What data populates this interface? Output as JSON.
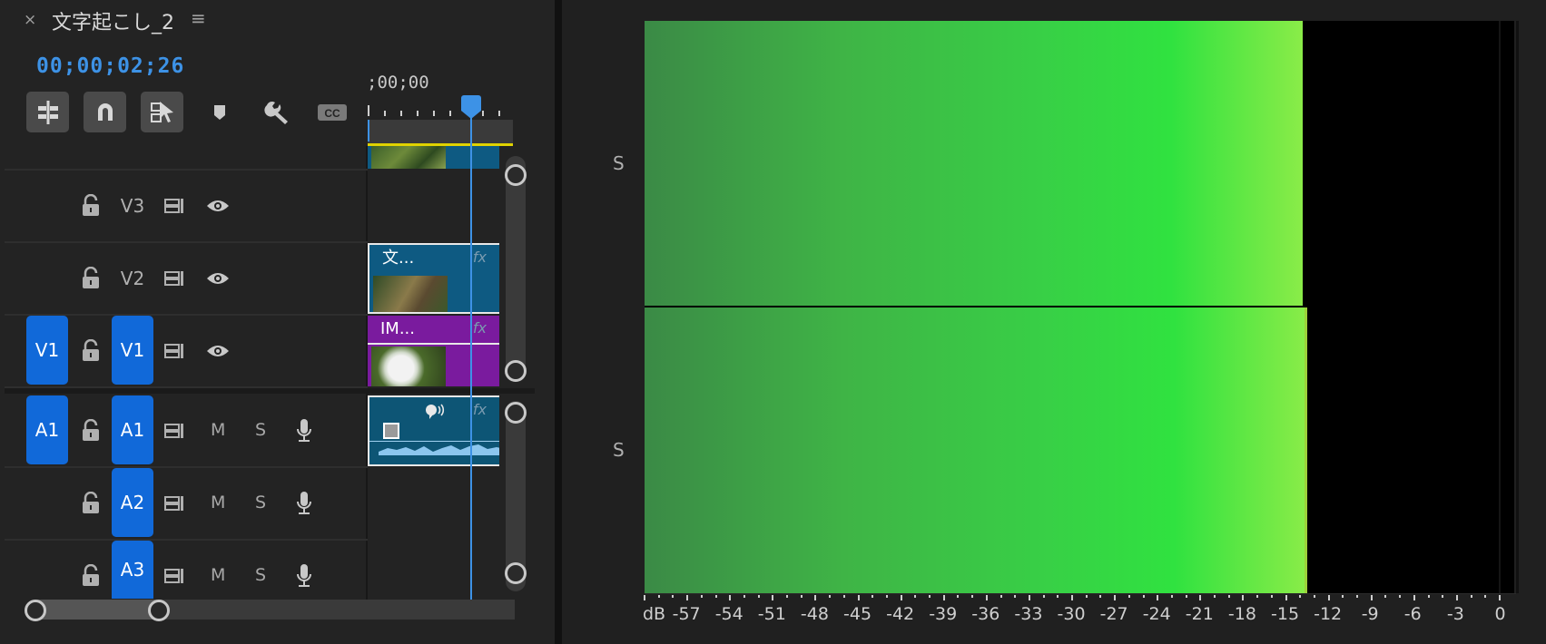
{
  "sequence": {
    "close_glyph": "×",
    "title": "文字起こし_2",
    "menu_glyph": "≡",
    "timecode": "00;00;02;26",
    "ruler_start": ";00;00"
  },
  "toolbar": {
    "icons": [
      "insert-nest-icon",
      "snap-magnet-icon",
      "linked-selection-icon",
      "add-marker-icon",
      "timeline-settings-wrench-icon",
      "captions-cc-icon"
    ]
  },
  "tracks": {
    "video": [
      {
        "name": "V3",
        "source": "",
        "targeted": false
      },
      {
        "name": "V2",
        "source": "",
        "targeted": false
      },
      {
        "name": "V1",
        "source": "V1",
        "targeted": true
      }
    ],
    "audio": [
      {
        "name": "A1",
        "source": "A1",
        "targeted": true,
        "mute": "M",
        "solo": "S"
      },
      {
        "name": "A2",
        "source": "",
        "targeted": true,
        "mute": "M",
        "solo": "S"
      },
      {
        "name": "A3",
        "source": "",
        "targeted": true,
        "mute": "M",
        "solo": "S"
      }
    ]
  },
  "clips": {
    "v2_title": "文...",
    "v1_title": "IM...",
    "fx_label": "fx"
  },
  "colors": {
    "accent": "#3d92e6",
    "target_blue": "#1169d9",
    "graphic_clip": "#0e5a82",
    "image_clip": "#7a1b9e",
    "audio_clip": "#0d5575",
    "meter_low": "#3b8a46",
    "meter_high": "#8aec48"
  },
  "audio_meter": {
    "channel_labels": [
      "S",
      "S"
    ],
    "levels_db": [
      -13.8,
      -13.5
    ],
    "peak_db": [
      -13.8,
      -13.5
    ],
    "scale_labels": [
      "dB",
      "-57",
      "-54",
      "-51",
      "-48",
      "-45",
      "-42",
      "-39",
      "-36",
      "-33",
      "-30",
      "-27",
      "-24",
      "-21",
      "-18",
      "-15",
      "-12",
      "-9",
      "-6",
      "-3",
      "0"
    ]
  }
}
